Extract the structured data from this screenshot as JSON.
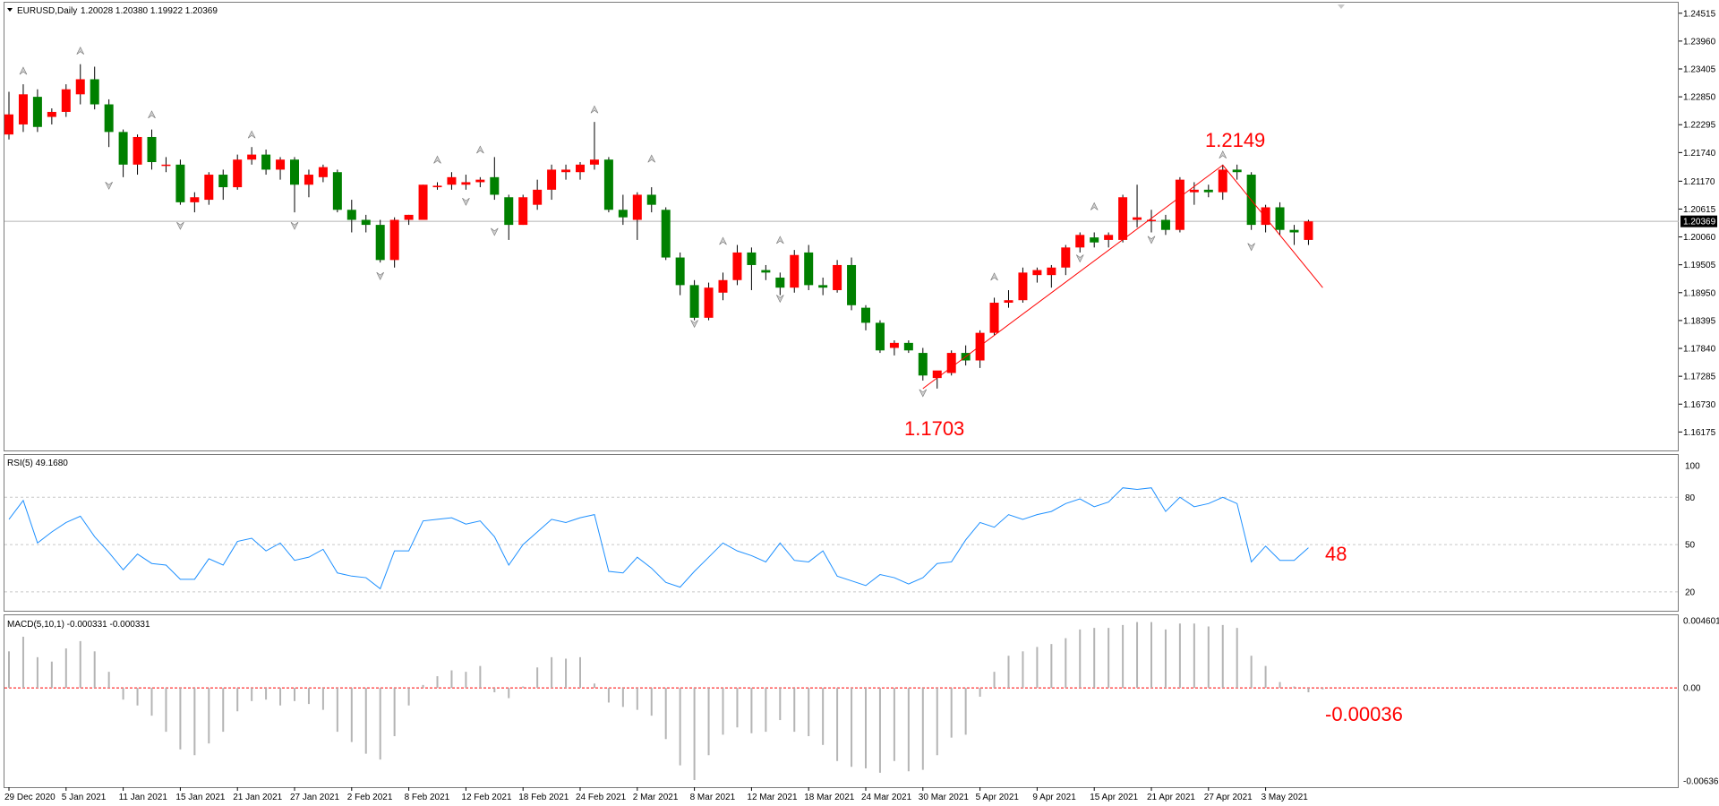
{
  "window": {
    "symbol_label": "EURUSD,Daily",
    "ohlc_label": "1.20028 1.20380 1.19922 1.20369",
    "current_price_label": "1.20369"
  },
  "colors": {
    "bull": "#ff0000",
    "bear": "#008000",
    "rsi_line": "#1e90ff",
    "trend": "#ff0000",
    "macd_hist": "#b4b4b4",
    "zero_line": "#ff0000",
    "grid": "#c8c8c8"
  },
  "annotations": {
    "high_label": "1.2149",
    "low_label": "1.1703",
    "rsi_value_label": "48",
    "macd_value_label": "-0.00036"
  },
  "chart_data": [
    {
      "type": "candlestick",
      "panel": "price",
      "title": "EURUSD,Daily",
      "ylim": [
        1.1595,
        1.246
      ],
      "yticks": [
        "1.24515",
        "1.23960",
        "1.23405",
        "1.22850",
        "1.22295",
        "1.21740",
        "1.21170",
        "1.20615",
        "1.20060",
        "1.19505",
        "1.18950",
        "1.18395",
        "1.17840",
        "1.17285",
        "1.16730",
        "1.16175"
      ],
      "xtick_labels": [
        {
          "i": 0,
          "label": "29 Dec 2020"
        },
        {
          "i": 4,
          "label": "5 Jan 2021"
        },
        {
          "i": 8,
          "label": "11 Jan 2021"
        },
        {
          "i": 12,
          "label": "15 Jan 2021"
        },
        {
          "i": 16,
          "label": "21 Jan 2021"
        },
        {
          "i": 20,
          "label": "27 Jan 2021"
        },
        {
          "i": 24,
          "label": "2 Feb 2021"
        },
        {
          "i": 28,
          "label": "8 Feb 2021"
        },
        {
          "i": 32,
          "label": "12 Feb 2021"
        },
        {
          "i": 36,
          "label": "18 Feb 2021"
        },
        {
          "i": 40,
          "label": "24 Feb 2021"
        },
        {
          "i": 44,
          "label": "2 Mar 2021"
        },
        {
          "i": 48,
          "label": "8 Mar 2021"
        },
        {
          "i": 52,
          "label": "12 Mar 2021"
        },
        {
          "i": 56,
          "label": "18 Mar 2021"
        },
        {
          "i": 60,
          "label": "24 Mar 2021"
        },
        {
          "i": 64,
          "label": "30 Mar 2021"
        },
        {
          "i": 68,
          "label": "5 Apr 2021"
        },
        {
          "i": 72,
          "label": "9 Apr 2021"
        },
        {
          "i": 76,
          "label": "15 Apr 2021"
        },
        {
          "i": 80,
          "label": "21 Apr 2021"
        },
        {
          "i": 84,
          "label": "27 Apr 2021"
        },
        {
          "i": 88,
          "label": "3 May 2021"
        }
      ],
      "current_price": 1.2037,
      "candles": [
        [
          1.221,
          1.2295,
          1.22,
          1.225
        ],
        [
          1.223,
          1.231,
          1.2215,
          1.229
        ],
        [
          1.2285,
          1.23,
          1.2215,
          1.2225
        ],
        [
          1.2245,
          1.2262,
          1.223,
          1.2255
        ],
        [
          1.2255,
          1.231,
          1.2245,
          1.23
        ],
        [
          1.229,
          1.235,
          1.227,
          1.232
        ],
        [
          1.232,
          1.2345,
          1.226,
          1.227
        ],
        [
          1.227,
          1.228,
          1.2185,
          1.2215
        ],
        [
          1.2215,
          1.222,
          1.2125,
          1.215
        ],
        [
          1.215,
          1.221,
          1.213,
          1.2205
        ],
        [
          1.2205,
          1.222,
          1.214,
          1.2155
        ],
        [
          1.215,
          1.2165,
          1.2135,
          1.215
        ],
        [
          1.215,
          1.216,
          1.207,
          1.2075
        ],
        [
          1.2075,
          1.2095,
          1.2055,
          1.2085
        ],
        [
          1.208,
          1.2135,
          1.207,
          1.213
        ],
        [
          1.213,
          1.214,
          1.208,
          1.2105
        ],
        [
          1.2105,
          1.217,
          1.21,
          1.216
        ],
        [
          1.216,
          1.2185,
          1.215,
          1.217
        ],
        [
          1.217,
          1.218,
          1.213,
          1.214
        ],
        [
          1.214,
          1.2165,
          1.212,
          1.216
        ],
        [
          1.216,
          1.2165,
          1.2055,
          1.211
        ],
        [
          1.211,
          1.214,
          1.2085,
          1.213
        ],
        [
          1.2125,
          1.215,
          1.2115,
          1.2145
        ],
        [
          1.2135,
          1.214,
          1.2055,
          1.206
        ],
        [
          1.206,
          1.208,
          1.2015,
          1.204
        ],
        [
          1.204,
          1.205,
          1.2015,
          1.203
        ],
        [
          1.203,
          1.204,
          1.1955,
          1.196
        ],
        [
          1.196,
          1.2045,
          1.1945,
          1.204
        ],
        [
          1.204,
          1.205,
          1.203,
          1.205
        ],
        [
          1.204,
          1.211,
          1.204,
          1.211
        ],
        [
          1.2105,
          1.2115,
          1.21,
          1.2108
        ],
        [
          1.211,
          1.2135,
          1.21,
          1.2125
        ],
        [
          1.211,
          1.213,
          1.21,
          1.2115
        ],
        [
          1.2115,
          1.2125,
          1.2105,
          1.212
        ],
        [
          1.2125,
          1.2165,
          1.208,
          1.209
        ],
        [
          1.2085,
          1.209,
          1.2,
          1.203
        ],
        [
          1.203,
          1.209,
          1.203,
          1.2085
        ],
        [
          1.207,
          1.212,
          1.206,
          1.21
        ],
        [
          1.21,
          1.215,
          1.208,
          1.214
        ],
        [
          1.2135,
          1.215,
          1.212,
          1.214
        ],
        [
          1.2135,
          1.2155,
          1.212,
          1.215
        ],
        [
          1.215,
          1.2235,
          1.214,
          1.216
        ],
        [
          1.216,
          1.2165,
          1.2055,
          1.206
        ],
        [
          1.206,
          1.209,
          1.203,
          1.2045
        ],
        [
          1.204,
          1.2095,
          1.2,
          1.209
        ],
        [
          1.209,
          1.2105,
          1.2055,
          1.207
        ],
        [
          1.206,
          1.2065,
          1.196,
          1.1965
        ],
        [
          1.1965,
          1.1975,
          1.189,
          1.191
        ],
        [
          1.191,
          1.192,
          1.184,
          1.1845
        ],
        [
          1.1845,
          1.1915,
          1.184,
          1.1905
        ],
        [
          1.1895,
          1.1935,
          1.188,
          1.192
        ],
        [
          1.192,
          1.199,
          1.191,
          1.1975
        ],
        [
          1.1975,
          1.1985,
          1.19,
          1.195
        ],
        [
          1.194,
          1.195,
          1.192,
          1.1935
        ],
        [
          1.1925,
          1.1935,
          1.189,
          1.1905
        ],
        [
          1.1905,
          1.198,
          1.1895,
          1.197
        ],
        [
          1.1975,
          1.199,
          1.19,
          1.191
        ],
        [
          1.191,
          1.1925,
          1.189,
          1.1905
        ],
        [
          1.19,
          1.196,
          1.1895,
          1.195
        ],
        [
          1.195,
          1.1965,
          1.186,
          1.187
        ],
        [
          1.1865,
          1.187,
          1.182,
          1.1835
        ],
        [
          1.1835,
          1.184,
          1.1775,
          1.178
        ],
        [
          1.1785,
          1.18,
          1.177,
          1.1795
        ],
        [
          1.1795,
          1.18,
          1.1775,
          1.178
        ],
        [
          1.1775,
          1.1785,
          1.172,
          1.173
        ],
        [
          1.1725,
          1.1735,
          1.1704,
          1.174
        ],
        [
          1.1735,
          1.178,
          1.173,
          1.1775
        ],
        [
          1.1775,
          1.179,
          1.175,
          1.176
        ],
        [
          1.176,
          1.182,
          1.1745,
          1.1815
        ],
        [
          1.1815,
          1.1885,
          1.181,
          1.1875
        ],
        [
          1.1875,
          1.19,
          1.1865,
          1.188
        ],
        [
          1.188,
          1.1945,
          1.1875,
          1.1935
        ],
        [
          1.193,
          1.1945,
          1.1915,
          1.194
        ],
        [
          1.193,
          1.195,
          1.1905,
          1.1945
        ],
        [
          1.1945,
          1.199,
          1.193,
          1.1985
        ],
        [
          1.1985,
          1.2015,
          1.1975,
          1.201
        ],
        [
          1.2005,
          1.2015,
          1.1985,
          1.1995
        ],
        [
          1.2,
          1.2015,
          1.1985,
          1.201
        ],
        [
          1.2,
          1.209,
          1.1995,
          1.2085
        ],
        [
          1.204,
          1.211,
          1.2025,
          1.2045
        ],
        [
          1.204,
          1.206,
          1.2015,
          1.204
        ],
        [
          1.204,
          1.205,
          1.201,
          1.202
        ],
        [
          1.202,
          1.2125,
          1.2015,
          1.212
        ],
        [
          1.2095,
          1.2115,
          1.207,
          1.21
        ],
        [
          1.21,
          1.211,
          1.2085,
          1.2095
        ],
        [
          1.2095,
          1.215,
          1.208,
          1.214
        ],
        [
          1.214,
          1.215,
          1.212,
          1.2135
        ],
        [
          1.213,
          1.2135,
          1.202,
          1.203
        ],
        [
          1.203,
          1.207,
          1.2015,
          1.2065
        ],
        [
          1.2065,
          1.2075,
          1.201,
          1.202
        ],
        [
          1.202,
          1.203,
          1.199,
          1.2015
        ],
        [
          1.2,
          1.204,
          1.199,
          1.2037
        ]
      ],
      "trendlines": [
        {
          "from": [
            64,
            1.1704
          ],
          "to": [
            85,
            1.2149
          ]
        },
        {
          "from": [
            85,
            1.2149
          ],
          "to": [
            92,
            1.1905
          ]
        }
      ],
      "fractals_up": [
        [
          1,
          1.2335
        ],
        [
          5,
          1.2375
        ],
        [
          10,
          1.2248
        ],
        [
          17,
          1.2208
        ],
        [
          30,
          1.2158
        ],
        [
          33,
          1.2178
        ],
        [
          41,
          1.2258
        ],
        [
          45,
          1.216
        ],
        [
          50,
          1.1996
        ],
        [
          54,
          1.1998
        ],
        [
          69,
          1.1925
        ],
        [
          76,
          1.2065
        ],
        [
          85,
          1.2168
        ]
      ],
      "fractals_down": [
        [
          7,
          1.211
        ],
        [
          12,
          1.203
        ],
        [
          20,
          1.203
        ],
        [
          26,
          1.193
        ],
        [
          32,
          1.2078
        ],
        [
          34,
          1.2018
        ],
        [
          48,
          1.1835
        ],
        [
          54,
          1.1885
        ],
        [
          64,
          1.1697
        ],
        [
          75,
          1.1965
        ],
        [
          80,
          1.2002
        ],
        [
          87,
          1.1988
        ]
      ]
    },
    {
      "type": "line",
      "panel": "rsi",
      "title": "RSI(5) 49.1680",
      "ylim": [
        12,
        104
      ],
      "yticks": [
        "100",
        "80",
        "50",
        "20"
      ],
      "levels": [
        80,
        50,
        20
      ],
      "series": [
        {
          "values": [
            66,
            78,
            51,
            58,
            64,
            68,
            55,
            45,
            34,
            44,
            38,
            37,
            28,
            28,
            41,
            37,
            52,
            54,
            46,
            51,
            40,
            42,
            47,
            32,
            30,
            29,
            22,
            46,
            46,
            65,
            66,
            67,
            63,
            65,
            55,
            37,
            50,
            58,
            66,
            64,
            67,
            69,
            33,
            32,
            42,
            35,
            26,
            23,
            33,
            42,
            51,
            46,
            43,
            39,
            51,
            40,
            39,
            46,
            30,
            27,
            24,
            31,
            29,
            25,
            29,
            38,
            39,
            53,
            64,
            61,
            69,
            66,
            69,
            71,
            76,
            79,
            74,
            77,
            86,
            85,
            86,
            71,
            80,
            74,
            76,
            80,
            76,
            39,
            49,
            40,
            40,
            48
          ]
        }
      ]
    },
    {
      "type": "bar",
      "panel": "macd",
      "title": "MACD(5,10,1) -0.000331 -0.000331",
      "ylim": [
        -0.006361,
        0.004601
      ],
      "yticks": [
        "0.004601",
        "0.00",
        "-0.006361"
      ],
      "values": [
        0.0025,
        0.0035,
        0.0021,
        0.0018,
        0.0027,
        0.0032,
        0.0025,
        0.0011,
        -0.0008,
        -0.0012,
        -0.0019,
        -0.003,
        -0.0042,
        -0.0046,
        -0.0038,
        -0.003,
        -0.0016,
        -0.0009,
        -0.0008,
        -0.0012,
        -0.0009,
        -0.0011,
        -0.0015,
        -0.003,
        -0.0037,
        -0.0045,
        -0.0049,
        -0.0033,
        -0.0012,
        0.0002,
        0.0008,
        0.0012,
        0.0011,
        0.0015,
        -0.0003,
        -0.0007,
        0.0001,
        0.0014,
        0.0021,
        0.002,
        0.0021,
        0.0003,
        -0.001,
        -0.0013,
        -0.0015,
        -0.0019,
        -0.0035,
        -0.0053,
        -0.0063,
        -0.0046,
        -0.0032,
        -0.0027,
        -0.0031,
        -0.003,
        -0.0022,
        -0.003,
        -0.0033,
        -0.0039,
        -0.005,
        -0.0054,
        -0.0055,
        -0.0058,
        -0.005,
        -0.0057,
        -0.0056,
        -0.0046,
        -0.0034,
        -0.0032,
        -0.0006,
        0.0011,
        0.0022,
        0.0025,
        0.0028,
        0.003,
        0.0034,
        0.004,
        0.0041,
        0.0041,
        0.0043,
        0.0045,
        0.0045,
        0.004,
        0.0044,
        0.0044,
        0.0042,
        0.0043,
        0.0041,
        0.0022,
        0.0015,
        0.0004,
        0.0001,
        -0.0003,
        -0.0001
      ]
    }
  ]
}
